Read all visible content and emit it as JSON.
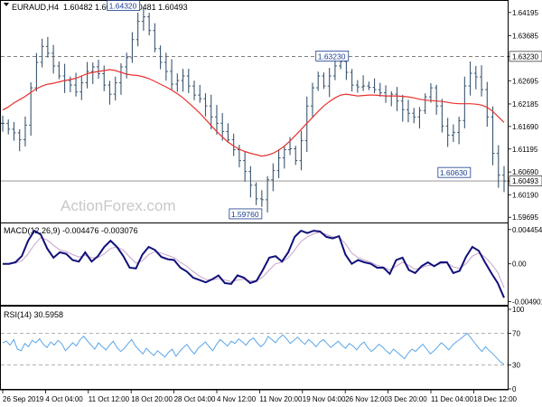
{
  "chart_data": {
    "type": "line",
    "instrument": "EURAUD,H4",
    "ohlc_text": "1.60482 1.60532 1.60481 1.60493",
    "watermark": "ActionForex.com",
    "x_labels": [
      "26 Sep 2019",
      "4 Oct 04:00",
      "11 Oct 12:00",
      "18 Oct 20:00",
      "28 Oct 04:00",
      "4 Nov 12:00",
      "11 Nov 20:00",
      "19 Nov 04:00",
      "26 Nov 12:00",
      "3 Dec 20:00",
      "11 Dec 04:00",
      "18 Dec 12:00"
    ],
    "price_panel": {
      "ylim": [
        1.5958,
        1.6445
      ],
      "ticks": [
        "1.64195",
        "1.63685",
        "1.63230",
        "1.62695",
        "1.62185",
        "1.61690",
        "1.61195",
        "1.60690",
        "1.60493",
        "1.60190",
        "1.59695"
      ],
      "current_price": "1.60493",
      "close_series": [
        1.6176,
        1.6163,
        1.6155,
        1.614,
        1.6172,
        1.6254,
        1.631,
        1.6345,
        1.633,
        1.6302,
        1.628,
        1.627,
        1.626,
        1.6245,
        1.6265,
        1.629,
        1.63,
        1.6285,
        1.626,
        1.624,
        1.6265,
        1.63,
        1.632,
        1.636,
        1.64,
        1.641,
        1.638,
        1.634,
        1.631,
        1.629,
        1.6262,
        1.627,
        1.628,
        1.6258,
        1.6238,
        1.623,
        1.6214,
        1.619,
        1.6176,
        1.6158,
        1.614,
        1.6118,
        1.6094,
        1.607,
        1.604,
        1.601,
        1.6008,
        1.6052,
        1.6072,
        1.61,
        1.6118,
        1.612,
        1.6094,
        1.6138,
        1.6214,
        1.6254,
        1.628,
        1.6258,
        1.628,
        1.6302,
        1.6312,
        1.6288,
        1.626,
        1.6256,
        1.6258,
        1.6255,
        1.625,
        1.6243,
        1.6236,
        1.624,
        1.6225,
        1.6206,
        1.6198,
        1.619,
        1.6204,
        1.6234,
        1.6254,
        1.6214,
        1.617,
        1.615,
        1.6156,
        1.6182,
        1.6258,
        1.6286,
        1.6278,
        1.625,
        1.619,
        1.611,
        1.6062,
        1.6049
      ],
      "ma_series": [
        1.6205,
        1.6212,
        1.6221,
        1.6228,
        1.6235,
        1.6244,
        1.6252,
        1.6258,
        1.6262,
        1.6264,
        1.6267,
        1.627,
        1.6272,
        1.6275,
        1.628,
        1.6285,
        1.6288,
        1.629,
        1.6292,
        1.6294,
        1.6292,
        1.6288,
        1.6284,
        1.6282,
        1.6281,
        1.6278,
        1.6274,
        1.6268,
        1.6262,
        1.6256,
        1.6249,
        1.6241,
        1.6232,
        1.6221,
        1.621,
        1.6198,
        1.6185,
        1.6171,
        1.6158,
        1.6146,
        1.6135,
        1.6126,
        1.6119,
        1.6114,
        1.611,
        1.6107,
        1.6104,
        1.6106,
        1.611,
        1.6117,
        1.6126,
        1.6137,
        1.615,
        1.6163,
        1.6176,
        1.6189,
        1.6202,
        1.6214,
        1.6224,
        1.6232,
        1.6238,
        1.624,
        1.6238,
        1.6236,
        1.6237,
        1.6238,
        1.6238,
        1.6237,
        1.6236,
        1.6236,
        1.6236,
        1.6235,
        1.6234,
        1.6232,
        1.6229,
        1.6227,
        1.6226,
        1.6225,
        1.6224,
        1.6222,
        1.622,
        1.6219,
        1.6219,
        1.6219,
        1.6218,
        1.6216,
        1.6211,
        1.6202,
        1.619,
        1.6178
      ],
      "annotations": [
        {
          "label": "1.64320",
          "value": 1.6432
        },
        {
          "label": "1.63230",
          "value": 1.6323
        },
        {
          "label": "1.59760",
          "value": 1.5976
        },
        {
          "label": "1.60630",
          "value": 1.6063
        }
      ]
    },
    "macd_panel": {
      "label": "MACD(12,26,9) -0.004476 -0.003076",
      "ticks": [
        "0.004454",
        "0.00",
        "-0.004901"
      ],
      "ylim": [
        -0.0052,
        0.0049
      ],
      "macd_series": [
        0.0,
        0.0,
        0.0002,
        0.001,
        0.003,
        0.0043,
        0.0038,
        0.002,
        0.0008,
        0.0015,
        0.0013,
        0.0005,
        0.0003,
        0.0015,
        0.0003,
        0.001,
        0.0022,
        0.003,
        0.0022,
        0.001,
        -0.0005,
        -0.0006,
        0.0012,
        0.0022,
        0.0018,
        0.0009,
        0.0006,
        0.0005,
        -0.0005,
        -0.001,
        -0.0018,
        -0.0021,
        -0.0024,
        -0.002,
        -0.0015,
        -0.0025,
        -0.0026,
        -0.0015,
        -0.0018,
        -0.0025,
        -0.0022,
        -0.0008,
        0.0008,
        0.001,
        0.0003,
        0.0015,
        0.0035,
        0.0043,
        0.004,
        0.0043,
        0.0042,
        0.0035,
        0.0033,
        0.0036,
        0.0012,
        0.0,
        0.0005,
        0.0002,
        0.0,
        -0.0005,
        -0.0005,
        -0.0013,
        0.0005,
        0.0008,
        -0.0008,
        -0.0012,
        -0.0003,
        0.0002,
        -0.0003,
        0.0002,
        0.0002,
        -0.0012,
        -0.0009,
        0.0009,
        0.0022,
        0.0017,
        0.0002,
        -0.0012,
        -0.0025,
        -0.0044
      ],
      "signal_series": [
        0.0,
        0.0,
        0.0001,
        0.0004,
        0.0013,
        0.0025,
        0.0034,
        0.0031,
        0.0024,
        0.0018,
        0.0016,
        0.0012,
        0.0009,
        0.0011,
        0.0008,
        0.0008,
        0.0013,
        0.002,
        0.0022,
        0.0018,
        0.0009,
        0.0001,
        0.0004,
        0.0012,
        0.0016,
        0.0014,
        0.0011,
        0.0008,
        0.0002,
        -0.0003,
        -0.001,
        -0.0016,
        -0.002,
        -0.0021,
        -0.0019,
        -0.0021,
        -0.0023,
        -0.0021,
        -0.002,
        -0.0022,
        -0.0022,
        -0.0017,
        -0.0008,
        0.0,
        0.0002,
        0.0008,
        0.0018,
        0.0029,
        0.0035,
        0.0039,
        0.0041,
        0.0038,
        0.0035,
        0.0035,
        0.0026,
        0.0014,
        0.0008,
        0.0005,
        0.0002,
        -0.0002,
        -0.0004,
        -0.0008,
        -0.0003,
        0.0002,
        -0.0002,
        -0.0007,
        -0.0005,
        -0.0002,
        -0.0002,
        0.0,
        0.0001,
        -0.0004,
        -0.0006,
        0.0,
        0.001,
        0.0014,
        0.0009,
        0.0,
        -0.0011,
        -0.0031
      ]
    },
    "rsi_panel": {
      "label": "RSI(14) 30.5958",
      "ticks": [
        "100",
        "70",
        "30",
        "0"
      ],
      "ylim": [
        0,
        100
      ],
      "levels": [
        70,
        30
      ],
      "values": [
        58,
        60,
        55,
        62,
        50,
        48,
        57,
        53,
        61,
        58,
        63,
        56,
        52,
        59,
        55,
        61,
        57,
        48,
        53,
        58,
        54,
        62,
        66,
        60,
        55,
        50,
        58,
        53,
        49,
        55,
        60,
        52,
        47,
        51,
        57,
        62,
        54,
        49,
        44,
        51,
        46,
        42,
        48,
        44,
        40,
        46,
        50,
        41,
        47,
        52,
        56,
        49,
        44,
        51,
        55,
        59,
        53,
        48,
        56,
        62,
        58,
        54,
        60,
        57,
        63,
        59,
        55,
        61,
        64,
        58,
        53,
        57,
        66,
        62,
        58,
        64,
        68,
        63,
        57,
        61,
        65,
        60,
        56,
        62,
        58,
        53,
        59,
        62,
        57,
        52,
        56,
        60,
        55,
        51,
        57,
        54,
        49,
        55,
        59,
        52,
        47,
        51,
        56,
        53,
        48,
        44,
        50,
        46,
        42,
        38,
        45,
        50,
        47,
        52,
        56,
        50,
        44,
        48,
        53,
        58,
        54,
        49,
        55,
        59,
        62,
        66,
        70,
        64,
        58,
        52,
        47,
        53,
        48,
        44,
        39,
        34,
        31
      ]
    }
  }
}
